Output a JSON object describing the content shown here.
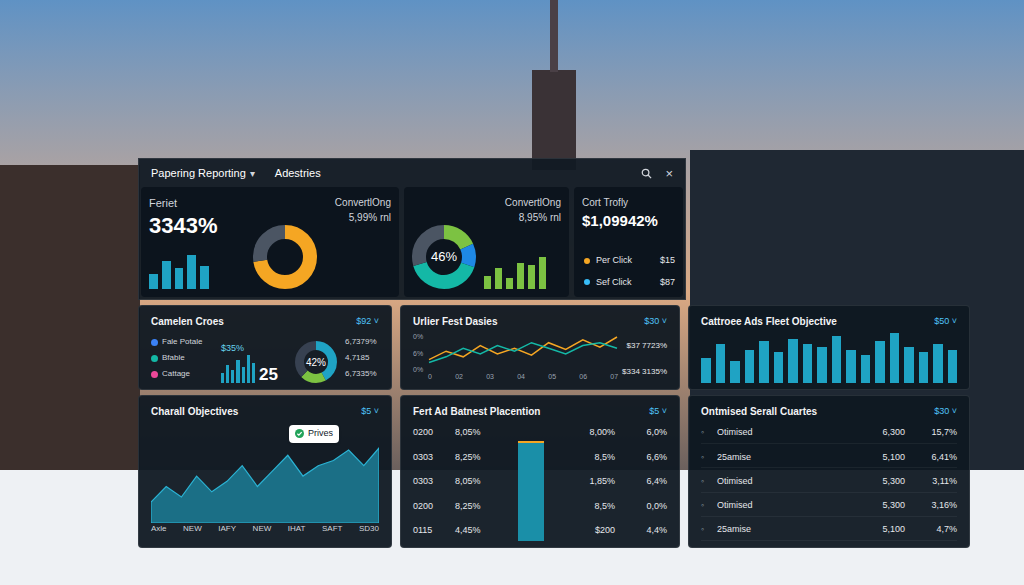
{
  "header": {
    "title": "Papering Reporting",
    "caret": "▾",
    "tab": "Adestries",
    "close": "×"
  },
  "summary_cards": {
    "card1": {
      "label": "Feriet",
      "value": "3343%",
      "subtitle": "ConvertlOng",
      "subvalue": "5,99% rnl",
      "donut": [
        {
          "value": 72,
          "color": "#f5a623"
        },
        {
          "value": 28,
          "color": "#4b5563"
        }
      ],
      "bars": [
        40,
        75,
        55,
        90,
        60
      ]
    },
    "card2": {
      "title": "ConvertlOng",
      "value": "8,95% rnl",
      "donut_label": "46%",
      "donut": [
        {
          "value": 18,
          "color": "#7cc242"
        },
        {
          "value": 12,
          "color": "#1e88e5"
        },
        {
          "value": 40,
          "color": "#14b8a6"
        },
        {
          "value": 30,
          "color": "#4b5563"
        }
      ],
      "bars": [
        35,
        55,
        30,
        70,
        65,
        85
      ]
    },
    "card3": {
      "title": "Cort Trofly",
      "value": "$1,09942%",
      "items": [
        {
          "label": "Per Click",
          "value": "$15",
          "color": "#f5a623"
        },
        {
          "label": "Sef Click",
          "value": "$87",
          "color": "#38bdf8"
        }
      ]
    }
  },
  "campaign": {
    "title": "Camelen Croes",
    "badge": "$92 ˅",
    "legend": [
      {
        "label": "Fale Potale",
        "color": "#3b82f6"
      },
      {
        "label": "Bfable",
        "color": "#14b8a6"
      },
      {
        "label": "Cattage",
        "color": "#ec4899"
      }
    ],
    "small_value": "$35%",
    "big_value": "25",
    "bars": [
      30,
      55,
      40,
      70,
      50,
      85,
      60
    ],
    "donut_label": "42%",
    "donut": [
      {
        "value": 42,
        "color": "#1fa3c4"
      },
      {
        "value": 20,
        "color": "#7cc242"
      },
      {
        "value": 38,
        "color": "#374151"
      }
    ],
    "values": [
      "6,7379%",
      "4,7185",
      "6,7335%"
    ]
  },
  "daily": {
    "title": "Urlier Fest Dasies",
    "badge": "$30 ˅",
    "y_ticks": [
      "0%",
      "6%",
      "0%"
    ],
    "x_ticks": [
      "0",
      "02",
      "03",
      "04",
      "05",
      "06",
      "07"
    ],
    "series": [
      {
        "color": "#f5a623",
        "values": [
          20,
          35,
          25,
          45,
          30,
          40,
          28,
          50,
          38,
          55,
          42,
          60
        ]
      },
      {
        "color": "#14b8a6",
        "values": [
          15,
          25,
          40,
          30,
          45,
          35,
          50,
          40,
          30,
          45,
          50,
          40
        ]
      }
    ],
    "labels": [
      "$37 7723%",
      "$334 3135%"
    ]
  },
  "objective": {
    "title": "Cattroee Ads Fleet Objective",
    "badge": "$50 ˅",
    "bars": [
      45,
      70,
      40,
      60,
      75,
      55,
      80,
      70,
      65,
      85,
      60,
      50,
      75,
      90,
      65,
      55,
      70,
      60
    ]
  },
  "overall": {
    "title": "Charall Objectives",
    "badge": "$5 ˅",
    "values": [
      20,
      35,
      25,
      45,
      30,
      40,
      55,
      35,
      50,
      65,
      45,
      55,
      60,
      70,
      55,
      72
    ],
    "tooltip": "Prives",
    "x_ticks": [
      "Axle",
      "NEW",
      "IAFY",
      "NEW",
      "IHAT",
      "SAFT",
      "SD30"
    ]
  },
  "placement": {
    "title": "Fert Ad Batnest Placention",
    "badge": "$5 ˅",
    "bar_level": 0.85,
    "rows": [
      [
        "0200",
        "8,05%",
        "8,00%",
        "6,0%"
      ],
      [
        "0303",
        "8,25%",
        "8,5%",
        "6,6%"
      ],
      [
        "0303",
        "8,05%",
        "1,85%",
        "6,4%"
      ],
      [
        "0200",
        "8,25%",
        "8,5%",
        "0,0%"
      ],
      [
        "0115",
        "4,45%",
        "$200",
        "4,4%"
      ]
    ]
  },
  "optimised": {
    "title": "Ontmised Serall Cuartes",
    "badge": "$30 ˅",
    "rows": [
      [
        "◦",
        "Otimised",
        "6,300",
        "15,7%"
      ],
      [
        "◦",
        "25amise",
        "5,100",
        "6,41%"
      ],
      [
        "◦",
        "Otimised",
        "5,300",
        "3,11%"
      ],
      [
        "◦",
        "Otimised",
        "5,300",
        "3,16%"
      ],
      [
        "◦",
        "25amise",
        "5,100",
        "4,7%"
      ]
    ]
  }
}
